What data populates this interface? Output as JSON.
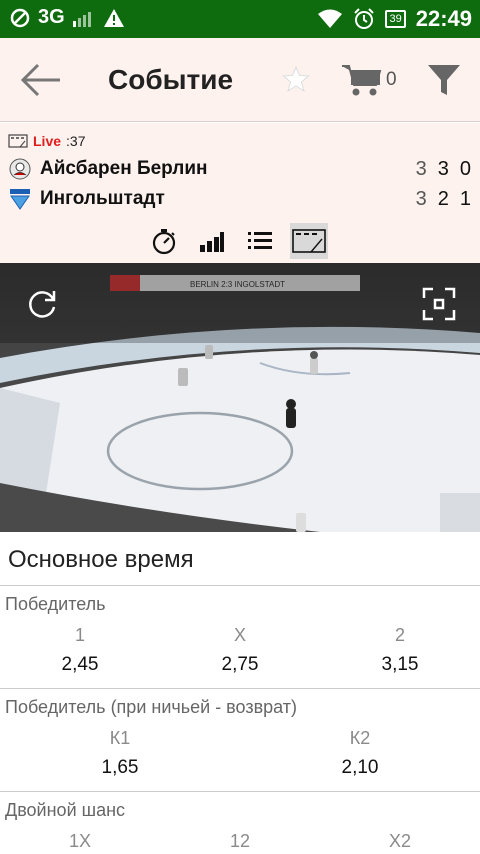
{
  "status_bar": {
    "network": "3G",
    "battery": "39",
    "time": "22:49"
  },
  "app_bar": {
    "title": "Событие",
    "cart_count": "0"
  },
  "event": {
    "live_label": "Live",
    "live_time": ":37",
    "teams": [
      {
        "name": "Айсбарен Берлин",
        "scores": [
          "3",
          "3",
          "0"
        ]
      },
      {
        "name": "Ингольштадт",
        "scores": [
          "3",
          "2",
          "1"
        ]
      }
    ],
    "tabs": [
      "timer-icon",
      "stats-icon",
      "list-icon",
      "video-icon"
    ]
  },
  "video": {
    "scoreboard_text": "BERLIN 2:3 INGOLSTADT"
  },
  "markets": {
    "section_title": "Основное время",
    "list": [
      {
        "name": "Победитель",
        "outcomes": [
          {
            "label": "1",
            "odd": "2,45"
          },
          {
            "label": "X",
            "odd": "2,75"
          },
          {
            "label": "2",
            "odd": "3,15"
          }
        ]
      },
      {
        "name": "Победитель (при ничьей - возврат)",
        "outcomes": [
          {
            "label": "К1",
            "odd": "1,65"
          },
          {
            "label": "К2",
            "odd": "2,10"
          }
        ]
      },
      {
        "name": "Двойной шанс",
        "outcomes": [
          {
            "label": "1X",
            "odd": ""
          },
          {
            "label": "12",
            "odd": ""
          },
          {
            "label": "X2",
            "odd": ""
          }
        ]
      }
    ]
  },
  "colors": {
    "status_bar": "#0e6b0e",
    "header_bg": "#fdf2ee",
    "live": "#e01e1e"
  }
}
